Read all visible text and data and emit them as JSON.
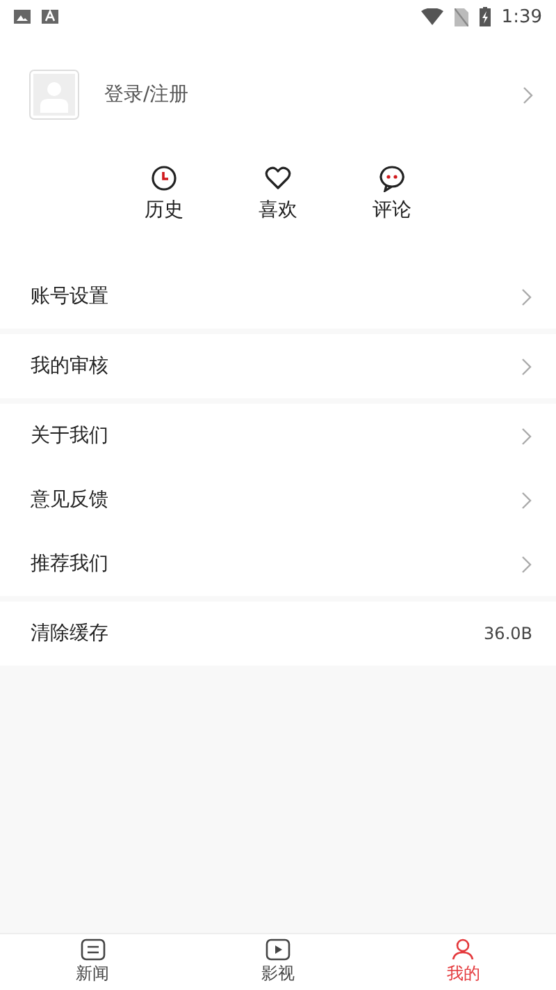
{
  "status_bar": {
    "time": "1:39"
  },
  "profile": {
    "login_label": "登录/注册"
  },
  "shortcuts": [
    {
      "kind": "history",
      "label": "历史"
    },
    {
      "kind": "like",
      "label": "喜欢"
    },
    {
      "kind": "comment",
      "label": "评论"
    }
  ],
  "menu_groups": [
    [
      {
        "label": "账号设置",
        "kind": "link"
      }
    ],
    [
      {
        "label": "我的审核",
        "kind": "link"
      }
    ],
    [
      {
        "label": "关于我们",
        "kind": "link"
      },
      {
        "label": "意见反馈",
        "kind": "link"
      },
      {
        "label": "推荐我们",
        "kind": "link"
      }
    ],
    [
      {
        "label": "清除缓存",
        "kind": "value",
        "value": "36.0B"
      }
    ]
  ],
  "bottom_nav": [
    {
      "label": "新闻",
      "kind": "news",
      "selected": false
    },
    {
      "label": "影视",
      "kind": "video",
      "selected": false
    },
    {
      "label": "我的",
      "kind": "me",
      "selected": true
    }
  ]
}
